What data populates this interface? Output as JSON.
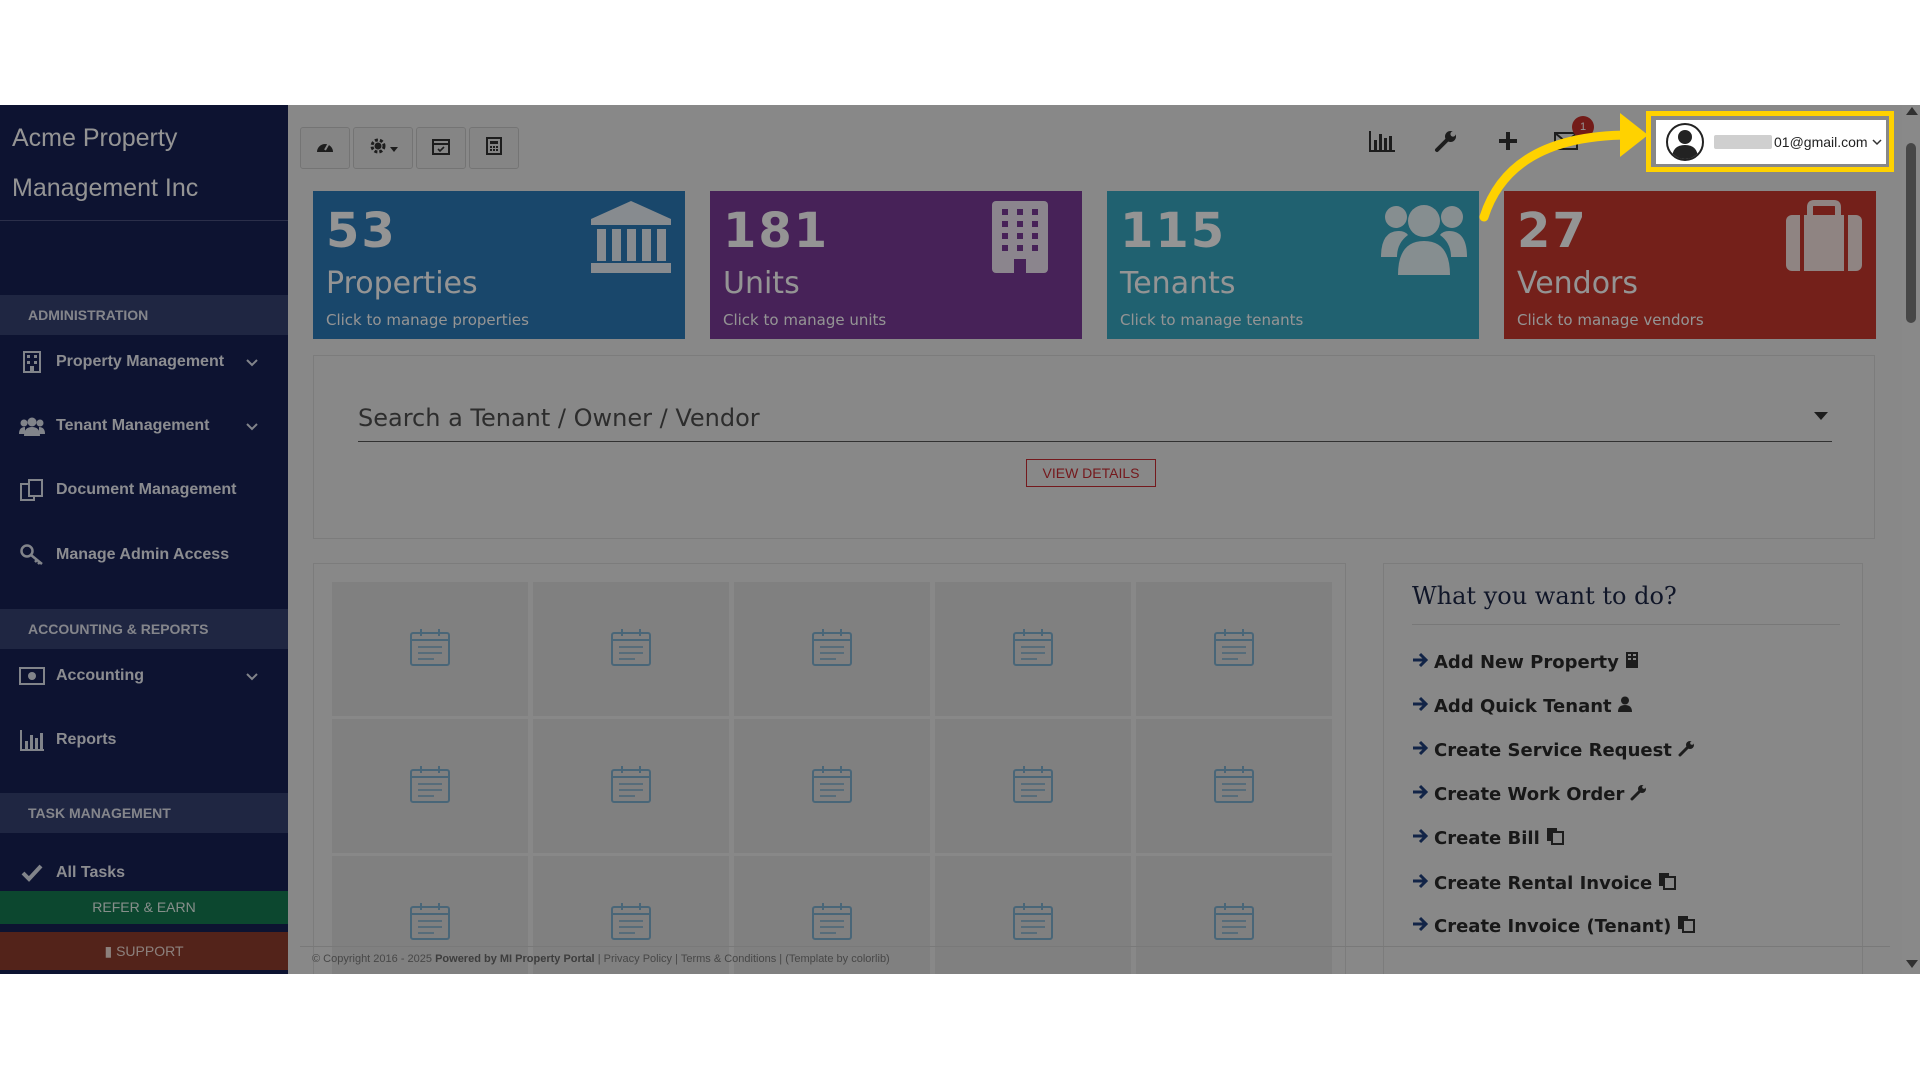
{
  "sidebar": {
    "brand": "Acme Property Management Inc",
    "sections": {
      "administration": "ADMINISTRATION",
      "accounting_reports": "ACCOUNTING & REPORTS",
      "task_management": "TASK MANAGEMENT"
    },
    "items": [
      {
        "label": "Property Management",
        "icon": "building-icon"
      },
      {
        "label": "Tenant Management",
        "icon": "users-icon"
      },
      {
        "label": "Document Management",
        "icon": "documents-icon"
      },
      {
        "label": "Manage Admin Access",
        "icon": "key-icon"
      },
      {
        "label": "Accounting",
        "icon": "money-icon"
      },
      {
        "label": "Reports",
        "icon": "bar-chart-icon"
      },
      {
        "label": "All Tasks",
        "icon": "check-icon"
      }
    ],
    "refer_label": "REFER & EARN",
    "support_label": "SUPPORT"
  },
  "toolbar": {
    "notification_count": "1",
    "user_email": "01@gmail.com"
  },
  "cards": [
    {
      "count": "53",
      "label": "Properties",
      "sub": "Click to manage properties",
      "color": "#2b7ab8",
      "icon": "bank-icon"
    },
    {
      "count": "181",
      "label": "Units",
      "sub": "Click to manage units",
      "color": "#7b3b98",
      "icon": "building-icon"
    },
    {
      "count": "115",
      "label": "Tenants",
      "sub": "Click to manage tenants",
      "color": "#38a7c2",
      "icon": "users-icon"
    },
    {
      "count": "27",
      "label": "Vendors",
      "sub": "Click to manage vendors",
      "color": "#c8382d",
      "icon": "briefcase-icon"
    }
  ],
  "search": {
    "placeholder": "Search a Tenant / Owner / Vendor",
    "view_details": "VIEW DETAILS"
  },
  "todo": {
    "title": "What you want to do?",
    "items": [
      {
        "label": "Add New Property",
        "icon": "building-icon"
      },
      {
        "label": "Add Quick Tenant",
        "icon": "user-icon"
      },
      {
        "label": "Create Service Request",
        "icon": "wrench-icon"
      },
      {
        "label": "Create Work Order",
        "icon": "wrench-icon"
      },
      {
        "label": "Create Bill",
        "icon": "copy-icon"
      },
      {
        "label": "Create Rental Invoice",
        "icon": "copy-icon"
      },
      {
        "label": "Create Invoice (Tenant)",
        "icon": "copy-icon"
      }
    ]
  },
  "footer": {
    "copyright": "© Copyright 2016 - 2025",
    "powered": "Powered by MI Property Portal",
    "links": "| Privacy Policy | Terms & Conditions |",
    "template": "(Template by colorlib)"
  },
  "colors": {
    "sidebar": "#182155",
    "highlight": "#ffd200",
    "accent_red": "#c92b33"
  }
}
